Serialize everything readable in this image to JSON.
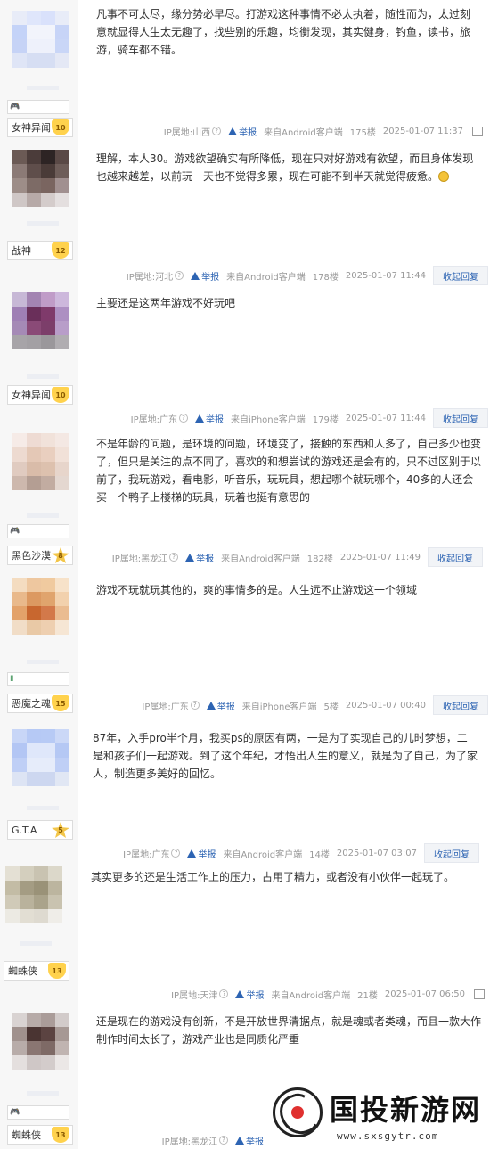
{
  "posts": [
    {
      "title": "女神异闻",
      "level": "10",
      "badge": "🎮",
      "content": "凡事不可太尽，缘分势必早尽。打游戏这种事情不必太执着，随性而为，太过刻意就显得人生太无趣了，找些别的乐趣，均衡发现，其实健身，钓鱼，读书，旅游，骑车都不错。",
      "ip": "IP属地:山西",
      "report": "举报",
      "source": "来自Android客户端",
      "floor": "175楼",
      "time": "2025-01-07 11:37",
      "reply": ""
    },
    {
      "title": "战神",
      "level": "12",
      "badge": "",
      "content": "理解，本人30。游戏欲望确实有所降低，现在只对好游戏有欲望，而且身体发现也越来越差，以前玩一天也不觉得多累，现在可能不到半天就觉得疲惫。",
      "ip": "IP属地:河北",
      "report": "举报",
      "source": "来自Android客户端",
      "floor": "178楼",
      "time": "2025-01-07 11:44",
      "reply": "收起回复"
    },
    {
      "title": "女神异闻",
      "level": "10",
      "badge": "",
      "content": "主要还是这两年游戏不好玩吧",
      "ip": "IP属地:广东",
      "report": "举报",
      "source": "来自iPhone客户端",
      "floor": "179楼",
      "time": "2025-01-07 11:44",
      "reply": "收起回复"
    },
    {
      "title": "黑色沙漠",
      "level": "8",
      "badge": "🎮",
      "content": "不是年龄的问题，是环境的问题，环境变了，接触的东西和人多了，自己多少也变了，但只是关注的点不同了，喜欢的和想尝试的游戏还是会有的，只不过区别于以前了，我玩游戏，看电影，听音乐，玩玩具，想起哪个就玩哪个，40多的人还会买一个鸭子上楼梯的玩具，玩着也挺有意思的",
      "ip": "IP属地:黑龙江",
      "report": "举报",
      "source": "来自Android客户端",
      "floor": "182楼",
      "time": "2025-01-07 11:49",
      "reply": "收起回复"
    },
    {
      "title": "恶魔之魂",
      "level": "15",
      "badge": "Ⅱ",
      "content": "游戏不玩就玩其他的，爽的事情多的是。人生远不止游戏这一个领域",
      "ip": "IP属地:广东",
      "report": "举报",
      "source": "来自iPhone客户端",
      "floor": "5楼",
      "time": "2025-01-07 00:40",
      "reply": "收起回复"
    },
    {
      "title": "G.T.A",
      "level": "5",
      "badge": "",
      "content": "87年，入手pro半个月，我买ps的原因有两，一是为了实现自己的儿时梦想，二是和孩子们一起游戏。到了这个年纪，才悟出人生的意义，就是为了自己，为了家人，制造更多美好的回忆。",
      "ip": "IP属地:广东",
      "report": "举报",
      "source": "来自Android客户端",
      "floor": "14楼",
      "time": "2025-01-07 03:07",
      "reply": "收起回复"
    },
    {
      "title": "蜘蛛侠",
      "level": "13",
      "badge": "",
      "content": "其实更多的还是生活工作上的压力，占用了精力，或者没有小伙伴一起玩了。",
      "ip": "IP属地:天津",
      "report": "举报",
      "source": "来自Android客户端",
      "floor": "21楼",
      "time": "2025-01-07 06:50",
      "reply": ""
    },
    {
      "title": "蜘蛛侠",
      "level": "13",
      "badge": "🎮",
      "content": "还是现在的游戏没有创新，不是开放世界清据点，就是魂或者类魂，而且一款大作制作时间太长了，游戏产业也是同质化严重",
      "ip": "IP属地:黑龙江",
      "report": "举报",
      "source": "",
      "floor": "",
      "time": "",
      "reply": ""
    }
  ],
  "watermark": {
    "title": "国投新游网",
    "url": "www.sxsgytr.com"
  },
  "colors": {
    "link": "#2d64b3",
    "meta": "#999999",
    "sidebar": "#f7f7f7"
  }
}
